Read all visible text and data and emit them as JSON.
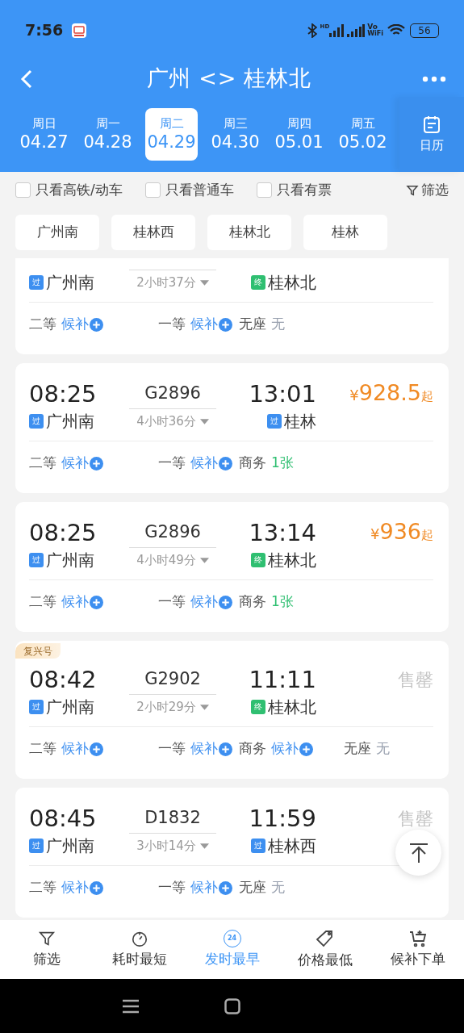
{
  "status_bar": {
    "time": "7:56",
    "hd": "HD",
    "vo": "Vo",
    "wifi": "WiFi",
    "battery": "56"
  },
  "header": {
    "title": "广州 <> 桂林北"
  },
  "dates": [
    {
      "weekday": "周日",
      "date": "04.27",
      "selected": false
    },
    {
      "weekday": "周一",
      "date": "04.28",
      "selected": false
    },
    {
      "weekday": "周二",
      "date": "04.29",
      "selected": true
    },
    {
      "weekday": "周三",
      "date": "04.30",
      "selected": false
    },
    {
      "weekday": "周四",
      "date": "05.01",
      "selected": false
    },
    {
      "weekday": "周五",
      "date": "05.02",
      "selected": false
    }
  ],
  "calendar_button": {
    "label": "日历"
  },
  "filters": [
    {
      "label": "只看高铁/动车",
      "checked": false
    },
    {
      "label": "只看普通车",
      "checked": false
    },
    {
      "label": "只看有票",
      "checked": false
    }
  ],
  "filter_button": {
    "label": "筛选"
  },
  "stations": [
    "广州南",
    "桂林西",
    "桂林北",
    "桂林"
  ],
  "trains": [
    {
      "from_badge": {
        "text": "过",
        "kind": "pass"
      },
      "from": "广州南",
      "duration": "2小时37分",
      "to_badge": {
        "text": "终",
        "kind": "terminal"
      },
      "to": "桂林北",
      "seats": [
        {
          "class": "二等",
          "status": "候补",
          "kind": "waitlist"
        },
        {
          "class": "一等",
          "status": "候补",
          "kind": "waitlist"
        },
        {
          "class": "无座",
          "status": "无",
          "kind": "none"
        }
      ]
    },
    {
      "depart": "08:25",
      "number": "G2896",
      "arrive": "13:01",
      "price": {
        "kind": "price",
        "currency": "¥",
        "amount": "928.5",
        "suffix": "起"
      },
      "from_badge": {
        "text": "过",
        "kind": "pass"
      },
      "from": "广州南",
      "duration": "4小时36分",
      "to_badge": {
        "text": "过",
        "kind": "pass"
      },
      "to": "桂林",
      "seats": [
        {
          "class": "二等",
          "status": "候补",
          "kind": "waitlist"
        },
        {
          "class": "一等",
          "status": "候补",
          "kind": "waitlist"
        },
        {
          "class": "商务",
          "status": "1张",
          "kind": "available"
        }
      ]
    },
    {
      "depart": "08:25",
      "number": "G2896",
      "arrive": "13:14",
      "price": {
        "kind": "price",
        "currency": "¥",
        "amount": "936",
        "suffix": "起"
      },
      "from_badge": {
        "text": "过",
        "kind": "pass"
      },
      "from": "广州南",
      "duration": "4小时49分",
      "to_badge": {
        "text": "终",
        "kind": "terminal"
      },
      "to": "桂林北",
      "seats": [
        {
          "class": "二等",
          "status": "候补",
          "kind": "waitlist"
        },
        {
          "class": "一等",
          "status": "候补",
          "kind": "waitlist"
        },
        {
          "class": "商务",
          "status": "1张",
          "kind": "available"
        }
      ]
    },
    {
      "tag": "复兴号",
      "depart": "08:42",
      "number": "G2902",
      "arrive": "11:11",
      "price": {
        "kind": "soldout",
        "text": "售罄"
      },
      "from_badge": {
        "text": "过",
        "kind": "pass"
      },
      "from": "广州南",
      "duration": "2小时29分",
      "to_badge": {
        "text": "终",
        "kind": "terminal"
      },
      "to": "桂林北",
      "seats": [
        {
          "class": "二等",
          "status": "候补",
          "kind": "waitlist"
        },
        {
          "class": "一等",
          "status": "候补",
          "kind": "waitlist"
        },
        {
          "class": "商务",
          "status": "候补",
          "kind": "waitlist"
        },
        {
          "class": "无座",
          "status": "无",
          "kind": "none"
        }
      ]
    },
    {
      "depart": "08:45",
      "number": "D1832",
      "arrive": "11:59",
      "price": {
        "kind": "soldout",
        "text": "售罄"
      },
      "from_badge": {
        "text": "过",
        "kind": "pass"
      },
      "from": "广州南",
      "duration": "3小时14分",
      "to_badge": {
        "text": "过",
        "kind": "pass"
      },
      "to": "桂林西",
      "seats": [
        {
          "class": "二等",
          "status": "候补",
          "kind": "waitlist"
        },
        {
          "class": "一等",
          "status": "候补",
          "kind": "waitlist"
        },
        {
          "class": "无座",
          "status": "无",
          "kind": "none"
        }
      ]
    }
  ],
  "bottom_nav": [
    {
      "label": "筛选",
      "selected": false
    },
    {
      "label": "耗时最短",
      "selected": false
    },
    {
      "label": "发时最早",
      "badge": "24",
      "selected": true
    },
    {
      "label": "价格最低",
      "selected": false
    },
    {
      "label": "候补下单",
      "selected": false
    }
  ]
}
